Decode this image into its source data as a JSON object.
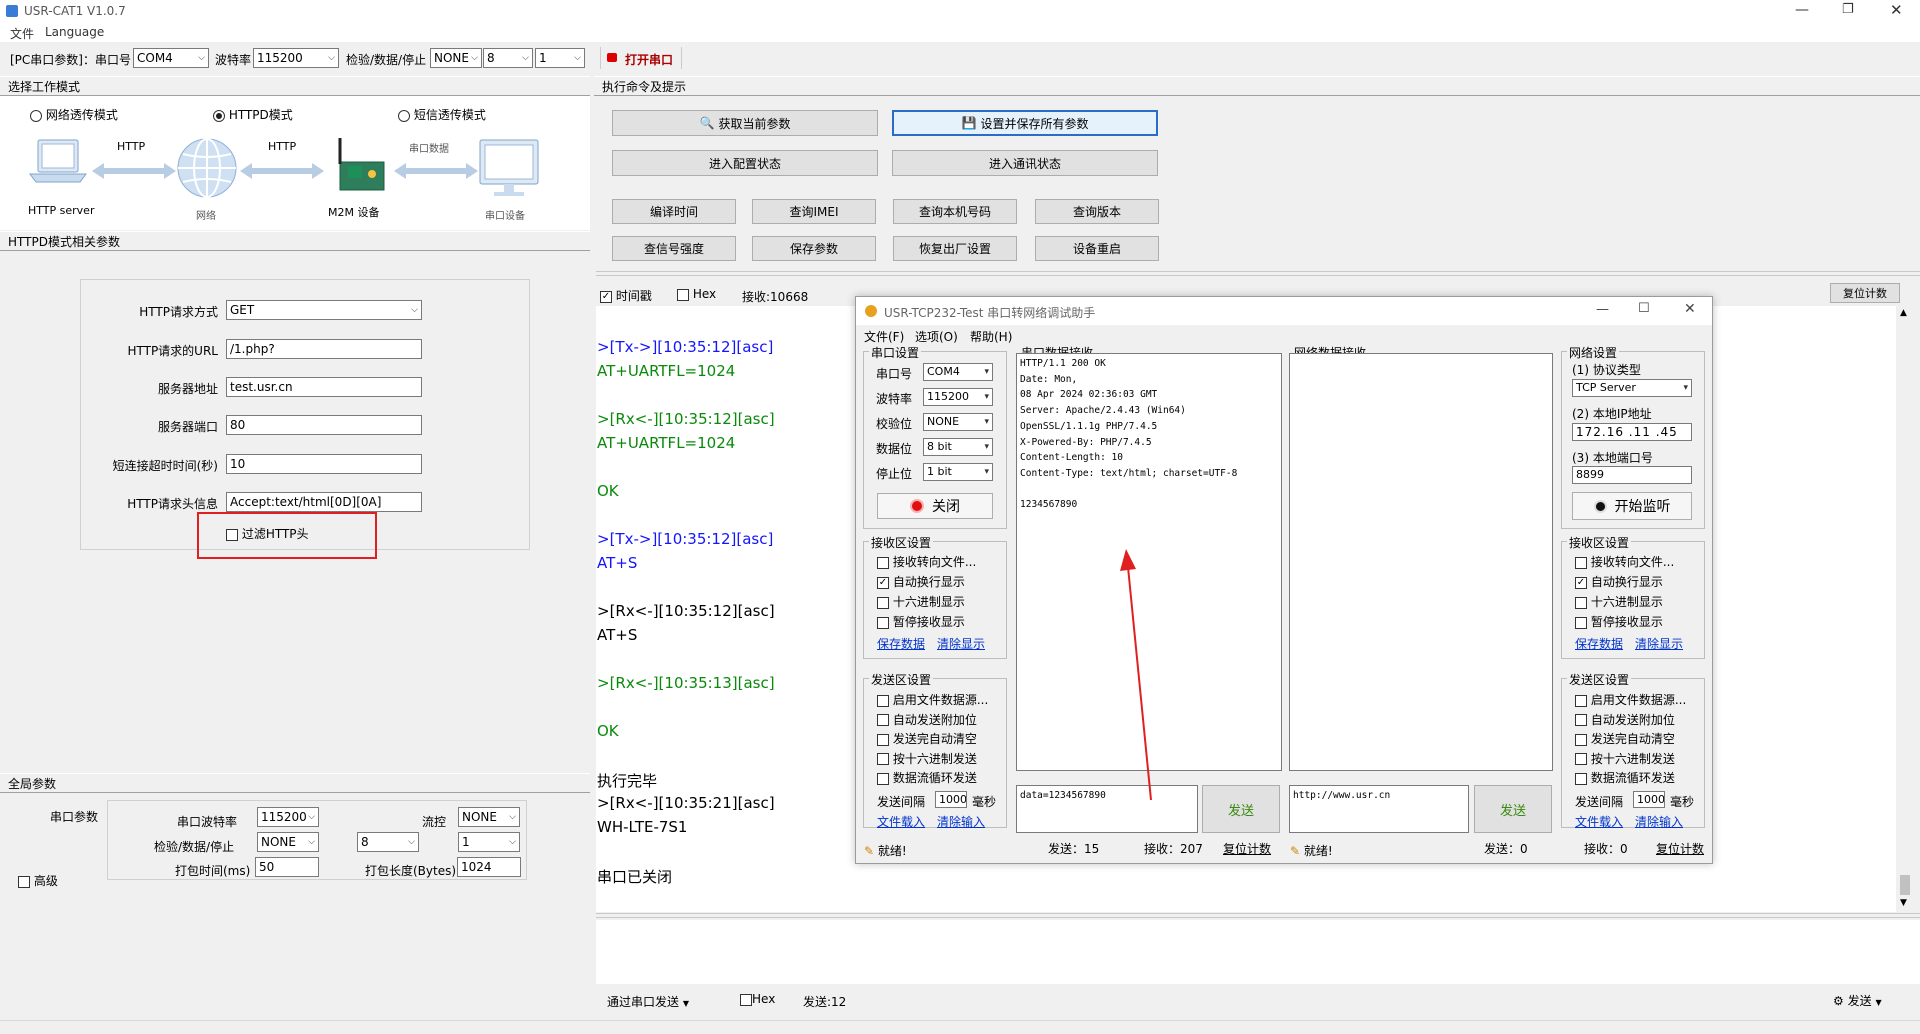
{
  "window": {
    "title": "USR-CAT1 V1.0.7",
    "menu": [
      "文件",
      "Language"
    ]
  },
  "toolbar": {
    "port_group": "[PC串口参数]：串口号",
    "port": "COM4",
    "baud_label": "波特率",
    "baud": "115200",
    "check_label": "检验/数据/停止",
    "parity": "NONE",
    "databits": "8",
    "stopbits": "1",
    "open_label": "打开串口"
  },
  "left": {
    "mode_title": "选择工作模式",
    "modes": [
      "网络透传模式",
      "HTTPD模式",
      "短信透传模式"
    ],
    "diagram": {
      "server": "HTTP server",
      "http1": "HTTP",
      "net": "网络",
      "http2": "HTTP",
      "m2m": "M2M 设备",
      "serial": "串口数据",
      "dev": "串口设备"
    },
    "httpd_title": "HTTPD模式相关参数",
    "http_fields": [
      {
        "label": "HTTP请求方式",
        "value": "GET"
      },
      {
        "label": "HTTP请求的URL",
        "value": "/1.php?"
      },
      {
        "label": "服务器地址",
        "value": "test.usr.cn"
      },
      {
        "label": "服务器端口",
        "value": "80"
      },
      {
        "label": "短连接超时时间(秒)",
        "value": "10"
      },
      {
        "label": "HTTP请求头信息",
        "value": "Accept:text/html[0D][0A]"
      }
    ],
    "filter_label": "过滤HTTP头",
    "global_title": "全局参数",
    "serial_params": "串口参数",
    "g_baud_label": "串口波特率",
    "g_baud": "115200",
    "flow_label": "流控",
    "flow": "NONE",
    "g_check_label": "检验/数据/停止",
    "g_parity": "NONE",
    "g_data": "8",
    "g_stop": "1",
    "pack_time_label": "打包时间(ms)",
    "pack_time": "50",
    "pack_len_label": "打包长度(Bytes)",
    "pack_len": "1024",
    "advanced": "高级"
  },
  "right": {
    "title": "执行命令及提示",
    "buttons": [
      "获取当前参数",
      "设置并保存所有参数",
      "进入配置状态",
      "进入通讯状态",
      "编译时间",
      "查询IMEI",
      "查询本机号码",
      "查询版本",
      "查信号强度",
      "保存参数",
      "恢复出厂设置",
      "设备重启"
    ],
    "timestamp": "时间戳",
    "hex": "Hex",
    "recv_count": "接收:10668",
    "reset_count": "复位计数",
    "log": [
      {
        "t": "tx",
        "s": ">[Tx->][10:35:12][asc]"
      },
      {
        "t": "rx",
        "s": "AT+UARTFL=1024"
      },
      {
        "t": "rx",
        "s": ">[Rx<-][10:35:12][asc]"
      },
      {
        "t": "rx",
        "s": "AT+UARTFL=1024"
      },
      {
        "t": "rx",
        "s": "OK"
      },
      {
        "t": "tx",
        "s": ">[Tx->][10:35:12][asc]"
      },
      {
        "t": "tx",
        "s": "AT+S"
      },
      {
        "t": "bk",
        "s": ">[Rx<-][10:35:12][asc]"
      },
      {
        "t": "bk",
        "s": "AT+S"
      },
      {
        "t": "rx",
        "s": ">[Rx<-][10:35:13][asc]"
      },
      {
        "t": "rx",
        "s": "OK"
      },
      {
        "t": "bk",
        "s": "执行完毕"
      },
      {
        "t": "bk",
        "s": ">[Rx<-][10:35:21][asc]"
      },
      {
        "t": "bk",
        "s": "WH-LTE-7S1"
      },
      {
        "t": "bk",
        "s": "串口已关闭"
      }
    ],
    "send_via": "通过串口发送",
    "send_hex": "Hex",
    "send_count": "发送:12",
    "send_btn": "发送"
  },
  "dialog": {
    "title": "USR-TCP232-Test 串口转网络调试助手",
    "menu": [
      "文件(F)",
      "选项(O)",
      "帮助(H)"
    ],
    "serial_group": "串口设置",
    "serial_rows": [
      {
        "label": "串口号",
        "value": "COM4"
      },
      {
        "label": "波特率",
        "value": "115200"
      },
      {
        "label": "校验位",
        "value": "NONE"
      },
      {
        "label": "数据位",
        "value": "8 bit"
      },
      {
        "label": "停止位",
        "value": "1 bit"
      }
    ],
    "close_btn": "关闭",
    "recv_group": "接收区设置",
    "recv_opts": [
      {
        "label": "接收转向文件...",
        "checked": false
      },
      {
        "label": "自动换行显示",
        "checked": true
      },
      {
        "label": "十六进制显示",
        "checked": false
      },
      {
        "label": "暂停接收显示",
        "checked": false
      }
    ],
    "save_data": "保存数据",
    "clear_disp": "清除显示",
    "send_group": "发送区设置",
    "send_opts": [
      "启用文件数据源...",
      "自动发送附加位",
      "发送完自动清空",
      "按十六进制发送",
      "数据流循环发送"
    ],
    "interval_label": "发送间隔",
    "interval": "1000",
    "ms": "毫秒",
    "file_load": "文件载入",
    "clear_input": "清除输入",
    "serial_recv_title": "串口数据接收",
    "serial_recv_text": "HTTP/1.1 200 OK\nDate: Mon,\n08 Apr 2024 02:36:03 GMT\nServer: Apache/2.4.43 (Win64)\nOpenSSL/1.1.1g PHP/7.4.5\nX-Powered-By: PHP/7.4.5\nContent-Length: 10\nContent-Type: text/html; charset=UTF-8\n\n1234567890",
    "net_recv_title": "网络数据接收",
    "serial_send_text": "data=1234567890",
    "net_send_text": "http://www.usr.cn",
    "send_btn": "发送",
    "status_ready": "就绪!",
    "stat_send": "发送：15",
    "stat_recv": "接收：207",
    "reset": "复位计数",
    "stat_send2": "发送：0",
    "stat_recv2": "接收：0",
    "net_group": "网络设置",
    "proto_label": "(1) 协议类型",
    "proto": "TCP Server",
    "ip_label": "(2) 本地IP地址",
    "ip": "172.16 .11 .45",
    "port_label": "(3) 本地端口号",
    "port": "8899",
    "listen_btn": "开始监听"
  }
}
